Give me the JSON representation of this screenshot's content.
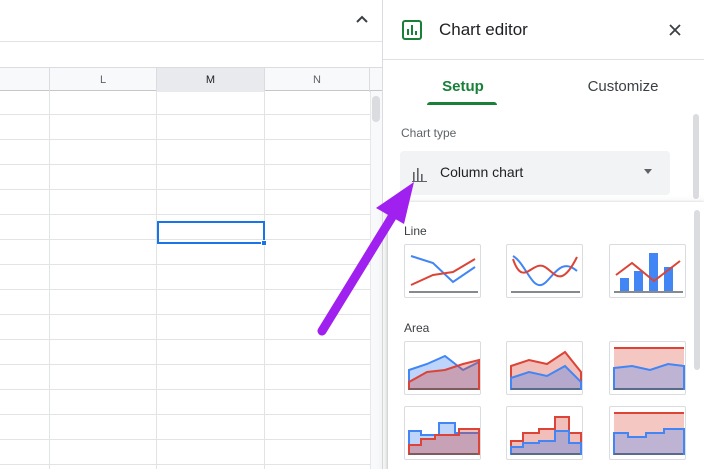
{
  "sheet": {
    "columns": [
      {
        "label": ""
      },
      {
        "label": "L"
      },
      {
        "label": "M"
      },
      {
        "label": "N"
      }
    ]
  },
  "editor": {
    "title": "Chart editor",
    "tabs": {
      "setup": "Setup",
      "customize": "Customize"
    },
    "chart_type_label": "Chart type",
    "chart_type_value": "Column chart"
  },
  "dropdown": {
    "groups": [
      {
        "label": "Line",
        "thumbs": [
          "line-chart-thumb",
          "smooth-line-chart-thumb",
          "combo-chart-thumb"
        ]
      },
      {
        "label": "Area",
        "thumbs": [
          "area-chart-thumb",
          "stacked-area-chart-thumb",
          "100-percent-stacked-area-chart-thumb",
          "stepped-area-chart-thumb",
          "stacked-stepped-area-chart-thumb",
          "100-percent-stacked-stepped-area-chart-thumb"
        ]
      }
    ]
  },
  "colors": {
    "accent_green": "#188038",
    "selection_blue": "#1a73e8",
    "series_red": "#db4437",
    "series_blue": "#4285f4",
    "arrow_purple": "#a020f0"
  }
}
